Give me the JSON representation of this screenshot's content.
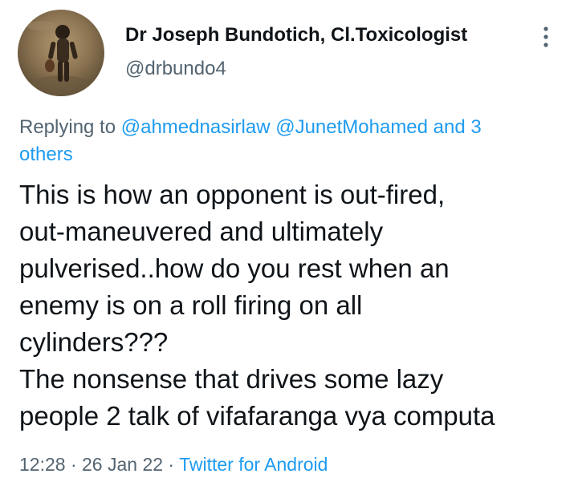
{
  "author": {
    "name": "Dr Joseph Bundotich, Cl.Toxicologist",
    "handle": "@drbundo4",
    "avatar_icon": "profile-photo-avatar"
  },
  "more_icon": "more-options-vertical-icon",
  "reply": {
    "prefix": "Replying to ",
    "mention_1": "@ahmednasirlaw",
    "mention_2": "@JunetMohamed",
    "suffix_line1": "and 3",
    "suffix_line2": "others"
  },
  "tweet": {
    "lines": [
      "This is how an opponent is out-fired,",
      "out-maneuvered and ultimately",
      "pulverised..how do you rest when an",
      "enemy is on a roll firing on all",
      "cylinders???",
      "The nonsense that drives some lazy",
      "people 2 talk of vifafaranga vya computa"
    ]
  },
  "meta": {
    "time": "12:28",
    "separator": " · ",
    "date": "26 Jan 22",
    "source": "Twitter for Android"
  },
  "colors": {
    "text": "#0f1419",
    "secondary": "#536471",
    "link": "#1d9bf0"
  }
}
